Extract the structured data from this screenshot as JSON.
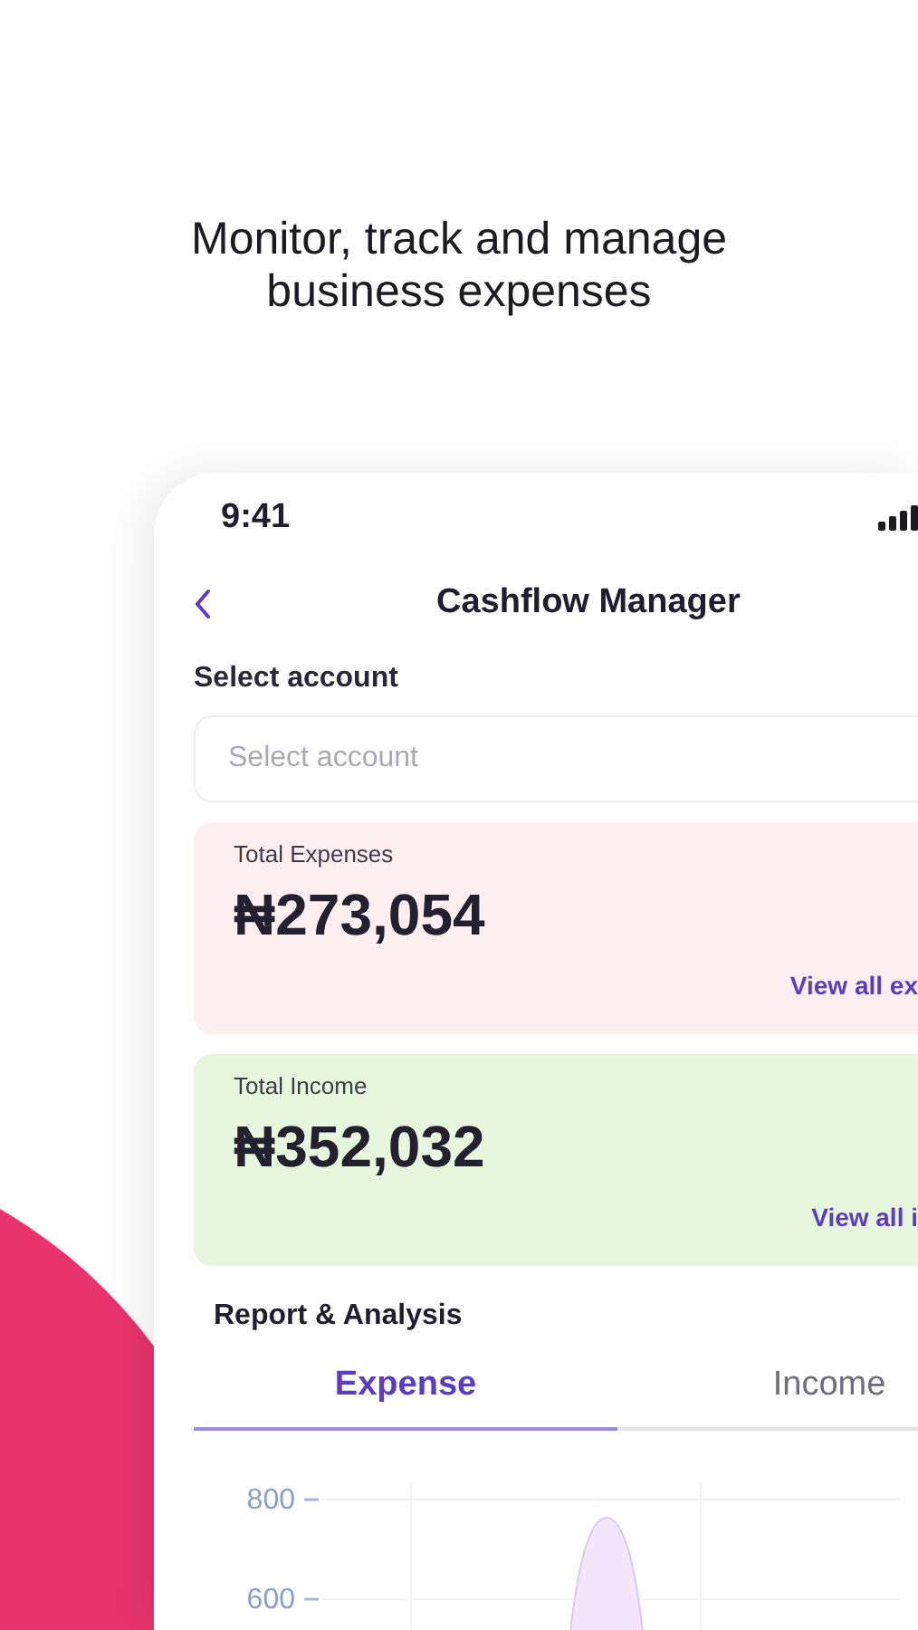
{
  "headline": "Monitor, track and manage business expenses",
  "status_bar": {
    "time": "9:41"
  },
  "header": {
    "title": "Cashflow Manager"
  },
  "account": {
    "label": "Select account",
    "placeholder": "Select account"
  },
  "summary_cards": [
    {
      "kind": "expense",
      "label": "Total Expenses",
      "amount": "₦273,054",
      "link": "View all ex"
    },
    {
      "kind": "income",
      "label": "Total Income",
      "amount": "₦352,032",
      "link": "View all i"
    }
  ],
  "report": {
    "title": "Report & Analysis",
    "tabs": [
      {
        "label": "Expense",
        "selected": true
      },
      {
        "label": "Income",
        "selected": false
      }
    ],
    "chart": {
      "y_labels": [
        "800",
        "600"
      ]
    }
  }
}
